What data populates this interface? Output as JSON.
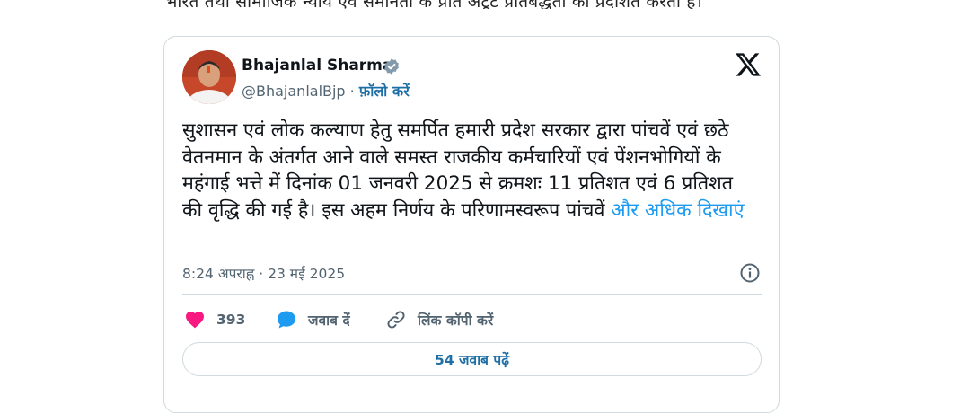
{
  "article": {
    "top_text": "भारत तथा सामाजिक न्याय एवं समानता के प्रति अटूट प्रतिबद्धता को प्रदर्शित करता है।"
  },
  "tweet": {
    "author_name": "Bhajanlal Sharma",
    "handle": "@BhajanlalBjp",
    "separator": " · ",
    "follow_label": "फ़ॉलो करें",
    "text": "सुशासन एवं लोक कल्याण हेतु समर्पित हमारी प्रदेश सरकार द्वारा पांचवें एवं छठे वेतनमान के अंतर्गत आने वाले समस्त राजकीय कर्मचारियों एवं पेंशनभोगियों के महंगाई भत्ते में दिनांक 01 जनवरी 2025 से क्रमशः 11 प्रतिशत एवं 6 प्रतिशत की वृद्धि की गई है। इस अहम निर्णय के परिणामस्वरूप पांचवें",
    "show_more_label": "और अधिक दिखाएं",
    "timestamp": "8:24 अपराह्न · 23 मई 2025",
    "likes_count": "393",
    "reply_label": "जवाब दें",
    "copy_link_label": "लिंक कॉपी करें",
    "read_replies_label": "54 जवाब पढ़ें"
  },
  "icons": {
    "verified": "verified-badge-icon",
    "x_logo": "x-logo-icon",
    "info": "info-icon",
    "like": "heart-icon",
    "reply": "speech-bubble-icon",
    "link": "link-icon"
  },
  "colors": {
    "accent_blue": "#1d9bf0",
    "follow_blue": "#1d6fa5",
    "like_pink": "#f91880",
    "muted_text": "#536471",
    "border": "#cfd9de"
  }
}
